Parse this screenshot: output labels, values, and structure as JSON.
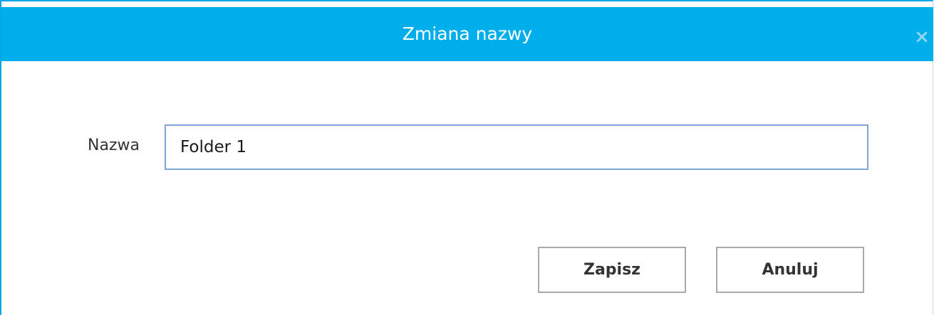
{
  "dialog": {
    "title": "Zmiana nazwy",
    "close_glyph": "×"
  },
  "form": {
    "name_label": "Nazwa",
    "name_value": "Folder 1"
  },
  "buttons": {
    "save_label": "Zapisz",
    "cancel_label": "Anuluj"
  },
  "colors": {
    "titlebar": "#01aeec",
    "input_border": "#7ea6d8",
    "button_border": "#a9a9a9"
  },
  "icons": {
    "close": "close-icon"
  }
}
